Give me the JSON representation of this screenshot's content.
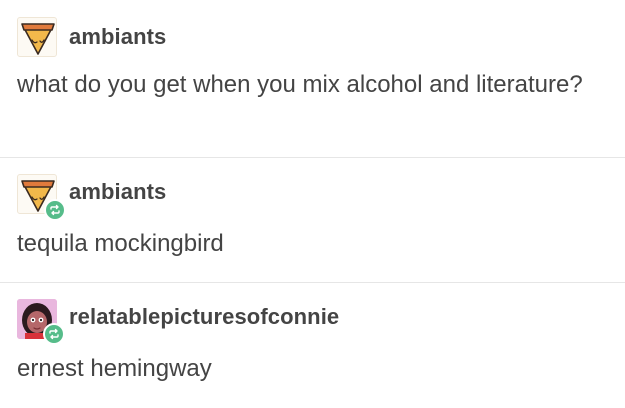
{
  "posts": [
    {
      "username": "ambiants",
      "avatar_icon": "pizza-slice-icon",
      "reblogged": false,
      "text": "what do you get when you mix alcohol and literature?"
    },
    {
      "username": "ambiants",
      "avatar_icon": "pizza-slice-icon",
      "reblogged": true,
      "text": "tequila mockingbird"
    },
    {
      "username": "relatablepicturesofconnie",
      "avatar_icon": "connie-portrait-icon",
      "reblogged": true,
      "text": "ernest hemingway"
    }
  ],
  "colors": {
    "text": "#444444",
    "reblog_badge": "#56bc8a",
    "divider": "#e6e6e6",
    "pizza_crust": "#e07a3c",
    "connie_bg": "#e9b7de"
  },
  "icons": {
    "reblog": "reblog-icon"
  }
}
